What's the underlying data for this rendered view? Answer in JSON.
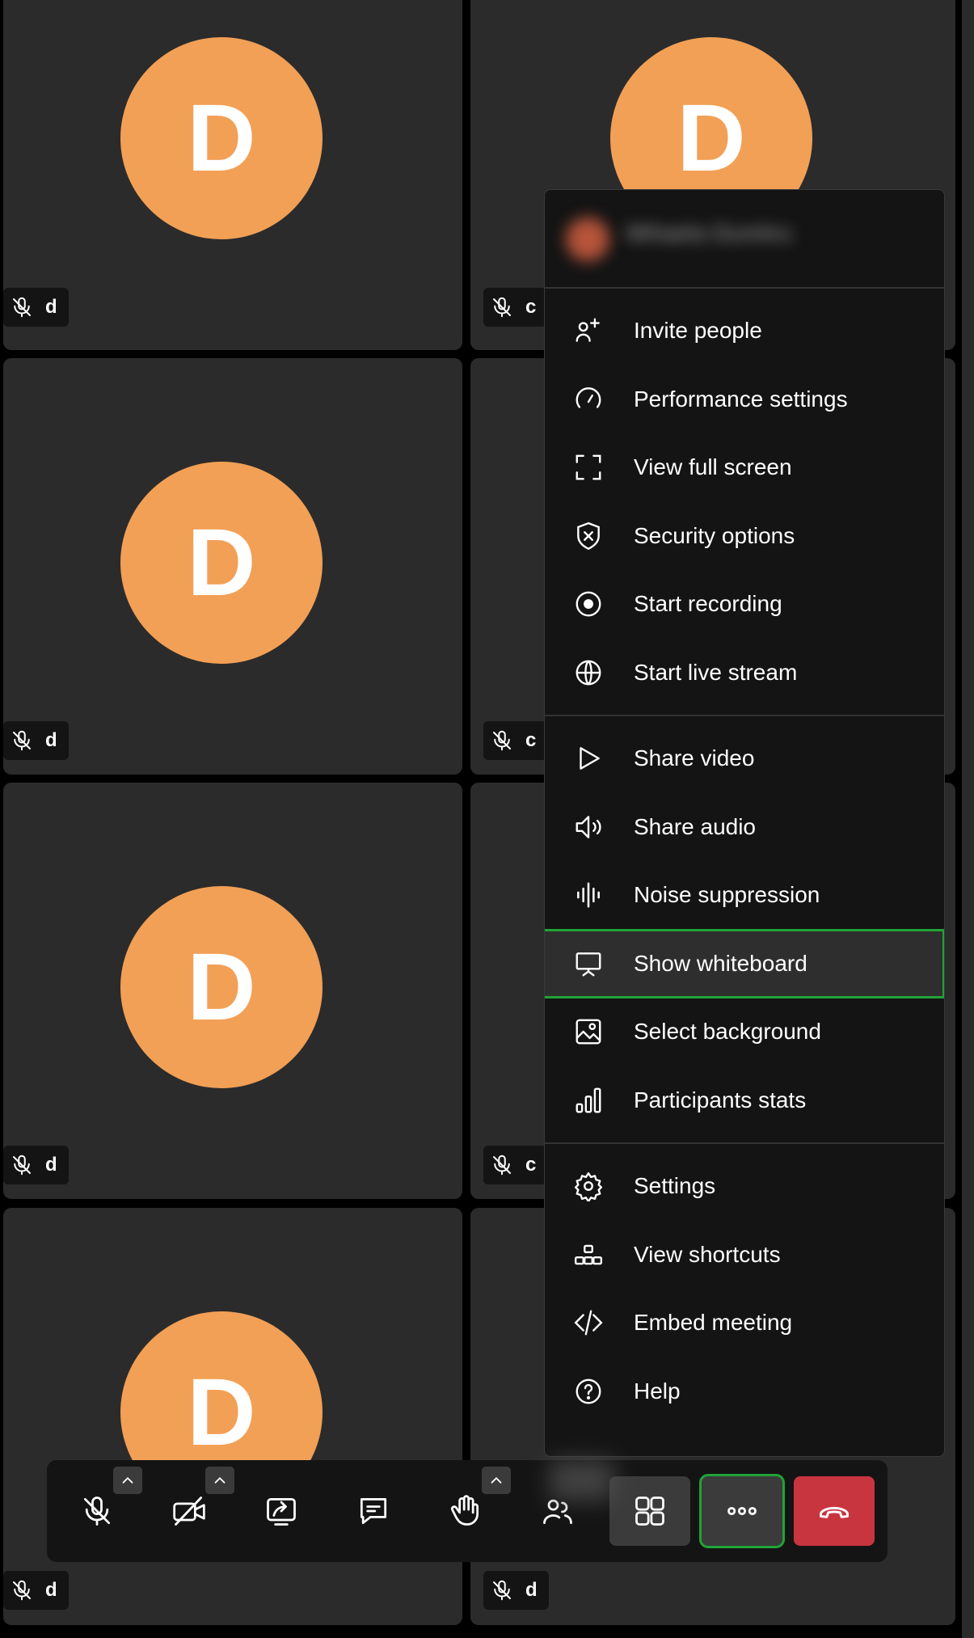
{
  "tiles": {
    "avatar_letter": "D",
    "participant_name": "d",
    "participant_name_cut": "c"
  },
  "menu": {
    "profile_name": "Mihaela Dumitru",
    "groups": [
      [
        {
          "label": "Invite people",
          "icon": "invite-people-icon"
        },
        {
          "label": "Performance settings",
          "icon": "gauge-icon"
        },
        {
          "label": "View full screen",
          "icon": "fullscreen-icon"
        },
        {
          "label": "Security options",
          "icon": "shield-icon"
        },
        {
          "label": "Start recording",
          "icon": "record-icon"
        },
        {
          "label": "Start live stream",
          "icon": "globe-icon"
        }
      ],
      [
        {
          "label": "Share video",
          "icon": "play-icon"
        },
        {
          "label": "Share audio",
          "icon": "speaker-icon"
        },
        {
          "label": "Noise suppression",
          "icon": "waveform-icon"
        },
        {
          "label": "Show whiteboard",
          "icon": "whiteboard-icon"
        },
        {
          "label": "Select background",
          "icon": "image-icon"
        },
        {
          "label": "Participants stats",
          "icon": "bar-chart-icon"
        }
      ],
      [
        {
          "label": "Settings",
          "icon": "gear-icon"
        },
        {
          "label": "View shortcuts",
          "icon": "shortcuts-icon"
        },
        {
          "label": "Embed meeting",
          "icon": "code-icon"
        },
        {
          "label": "Help",
          "icon": "help-icon"
        }
      ]
    ]
  },
  "toolbar": {
    "buttons": [
      "mute-microphone",
      "stop-camera",
      "share-screen",
      "chat",
      "raise-hand",
      "participants",
      "tile-view",
      "more-actions",
      "leave-meeting"
    ]
  },
  "colors": {
    "avatar": "#f2a056",
    "highlight": "#21a336",
    "hangup": "#c9353f"
  }
}
